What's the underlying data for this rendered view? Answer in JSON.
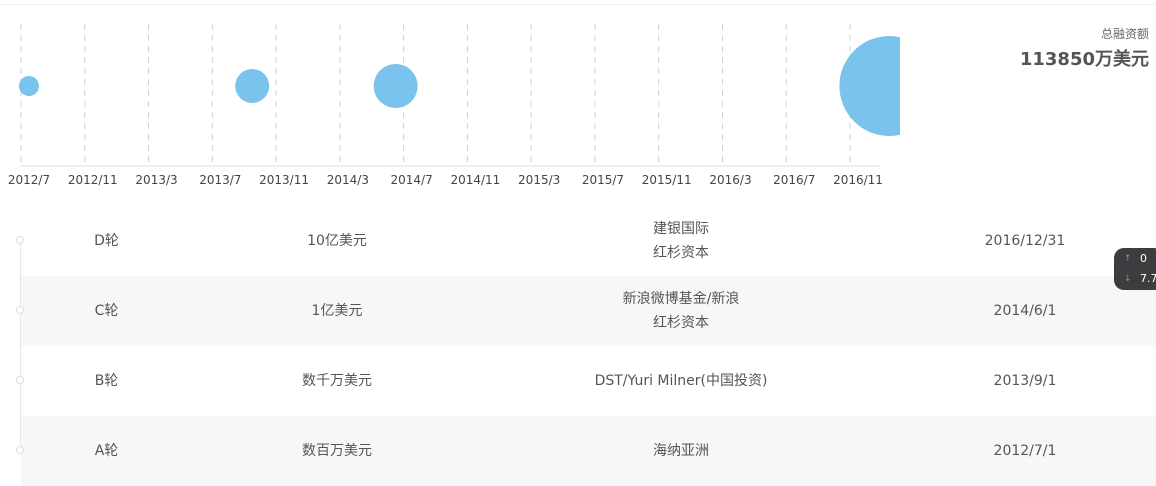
{
  "summary": {
    "label": "总融资额",
    "value": "113850万美元"
  },
  "chart_data": {
    "type": "scatter",
    "x_ticks": [
      "2012/7",
      "2012/11",
      "2013/3",
      "2013/7",
      "2013/11",
      "2014/3",
      "2014/7",
      "2014/11",
      "2015/3",
      "2015/7",
      "2015/11",
      "2016/3",
      "2016/7",
      "2016/11"
    ],
    "points": [
      {
        "date": "2012/7/1",
        "round": "A轮"
      },
      {
        "date": "2013/9/1",
        "round": "B轮"
      },
      {
        "date": "2014/6/1",
        "round": "C轮"
      },
      {
        "date": "2016/12/31",
        "round": "D轮"
      }
    ],
    "grid": true,
    "legend": "none",
    "bubble_color": "#7ac3ec"
  },
  "rounds": [
    {
      "round": "D轮",
      "amount": "10亿美元",
      "investors": [
        "建银国际",
        "红杉资本"
      ],
      "date": "2016/12/31"
    },
    {
      "round": "C轮",
      "amount": "1亿美元",
      "investors": [
        "新浪微博基金/新浪",
        "红杉资本"
      ],
      "date": "2014/6/1"
    },
    {
      "round": "B轮",
      "amount": "数千万美元",
      "investors": [
        "DST/Yuri Milner(中国投资)"
      ],
      "date": "2013/9/1"
    },
    {
      "round": "A轮",
      "amount": "数百万美元",
      "investors": [
        "海纳亚洲"
      ],
      "date": "2012/7/1"
    }
  ],
  "widget": {
    "up_value": "0",
    "down_value": "7.7"
  }
}
